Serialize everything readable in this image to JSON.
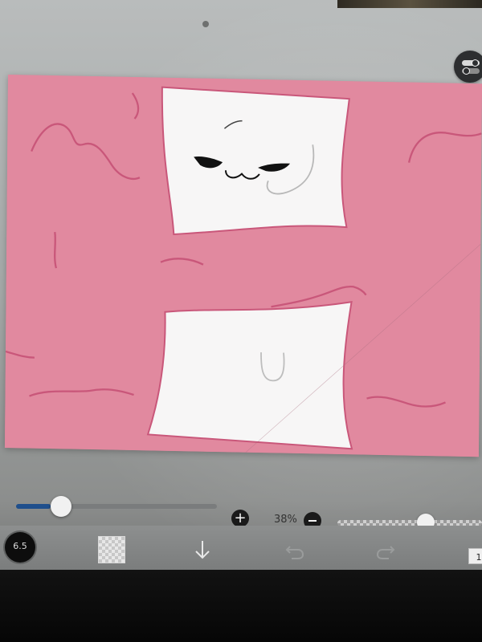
{
  "colors": {
    "canvas_pink": "#e1899f",
    "outline": "#c9577a",
    "accent_blue": "#1f4f8c"
  },
  "canvas": {
    "description_icon": "drawing-canvas"
  },
  "controls": {
    "brush_size_slider": {
      "value_fraction": 0.17
    },
    "zoom_in_icon": "plus-icon",
    "zoom_label": "38%",
    "zoom_out_icon": "minus-icon",
    "opacity_slider": {
      "value_fraction": 0.55
    }
  },
  "toolbar": {
    "brush_size": "6.5",
    "color_icon": "transparent-color-swatch",
    "download_icon": "down-arrow-icon",
    "undo_icon": "undo-icon",
    "redo_icon": "redo-icon",
    "layers_count": "1"
  }
}
